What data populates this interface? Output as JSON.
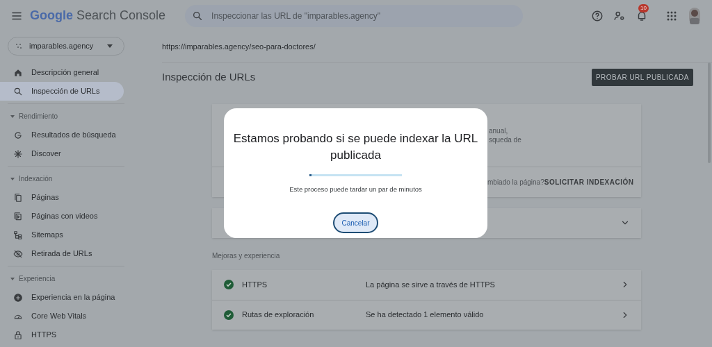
{
  "header": {
    "logo_google": "Google",
    "logo_product": "Search Console",
    "search": {
      "placeholder": "Inspeccionar las URL de \"imparables.agency\""
    },
    "notification_count": "10"
  },
  "property": {
    "name": "imparables.agency"
  },
  "sidebar": {
    "items": [
      {
        "kind": "item",
        "label": "Descripción general",
        "selected": false
      },
      {
        "kind": "item",
        "label": "Inspección de URLs",
        "selected": true
      },
      {
        "kind": "section",
        "label": "Rendimiento",
        "expanded": true,
        "children": [
          {
            "label": "Resultados de búsqueda",
            "selected": false
          },
          {
            "label": "Discover",
            "selected": false
          }
        ]
      },
      {
        "kind": "section",
        "label": "Indexación",
        "expanded": true,
        "children": [
          {
            "label": "Páginas",
            "selected": false
          },
          {
            "label": "Páginas con videos",
            "selected": false
          },
          {
            "label": "Sitemaps",
            "selected": false
          },
          {
            "label": "Retirada de URLs",
            "selected": false
          }
        ]
      },
      {
        "kind": "section",
        "label": "Experiencia",
        "expanded": true,
        "children": [
          {
            "label": "Experiencia en la página",
            "selected": false
          },
          {
            "label": "Core Web Vitals",
            "selected": false
          },
          {
            "label": "HTTPS",
            "selected": false
          }
        ]
      }
    ]
  },
  "main": {
    "url": "https://imparables.agency/seo-para-doctores/",
    "title": "Inspección de URLs",
    "test_button": "PROBAR URL PUBLICADA",
    "status_card": {
      "text_lines": [
        "anual,",
        "squeda de"
      ],
      "question": "mbiado la página?",
      "action": "SOLICITAR INDEXACIÓN"
    },
    "section_label": "Mejoras y experiencia",
    "enhancements": [
      {
        "name": "HTTPS",
        "status": "La página se sirve a través de HTTPS"
      },
      {
        "name": "Rutas de exploración",
        "status": "Se ha detectado 1 elemento válido"
      }
    ]
  },
  "dialog": {
    "title": "Estamos probando si se puede indexar la URL publicada",
    "progress": {
      "level": 0.02
    },
    "message": "Este proceso puede tardar un par de minutos",
    "cancel": "Cancelar"
  }
}
